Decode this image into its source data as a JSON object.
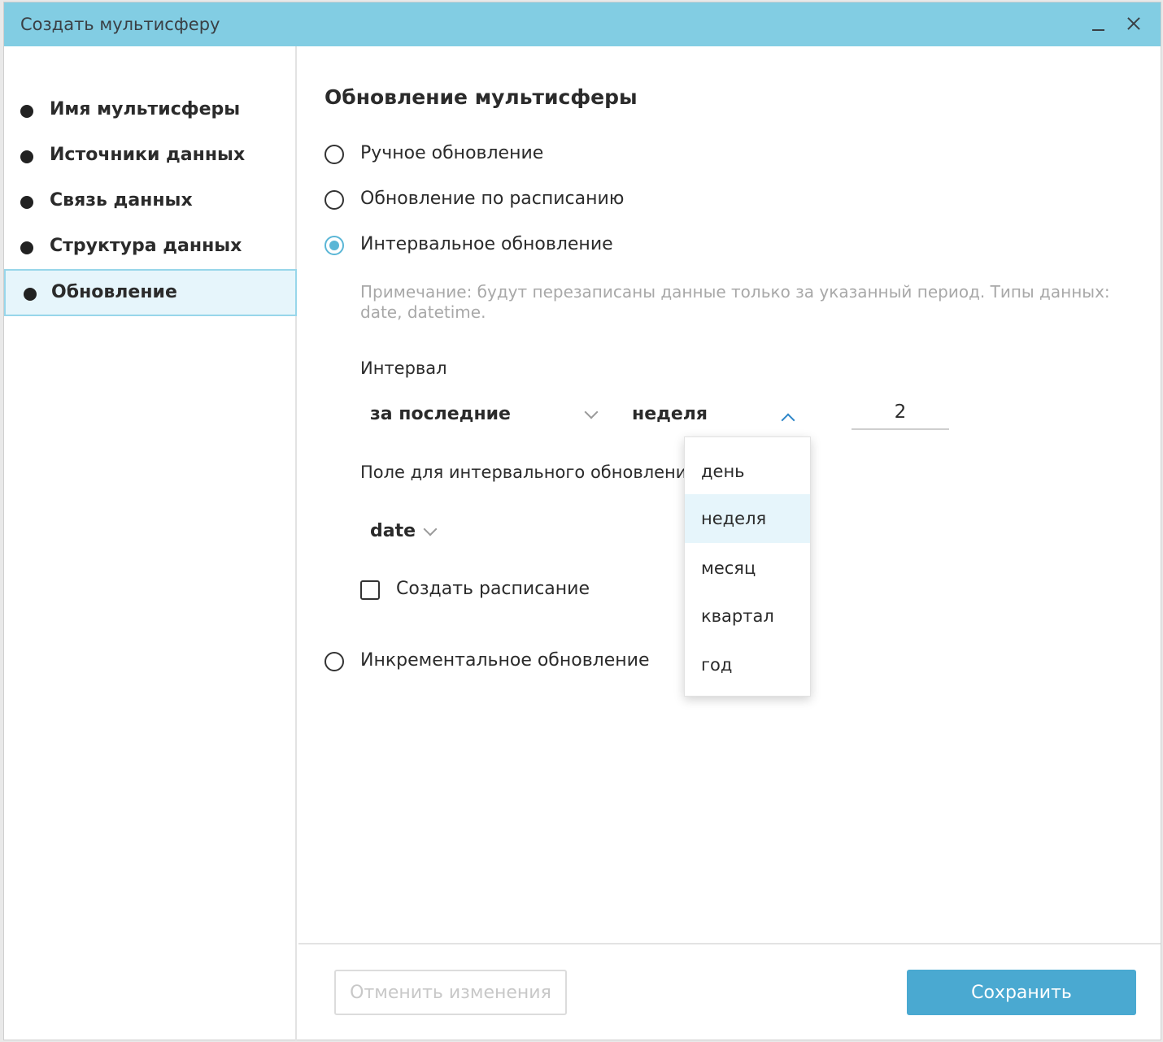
{
  "window": {
    "title": "Создать мультисферу"
  },
  "sidebar": {
    "steps": [
      {
        "label": "Имя мультисферы"
      },
      {
        "label": "Источники данных"
      },
      {
        "label": "Связь данных"
      },
      {
        "label": "Структура данных"
      },
      {
        "label": "Обновление",
        "active": true
      }
    ]
  },
  "main": {
    "heading": "Обновление мультисферы",
    "update_modes": [
      {
        "label": "Ручное обновление",
        "checked": false
      },
      {
        "label": "Обновление по расписанию",
        "checked": false
      },
      {
        "label": "Интервальное обновление",
        "checked": true
      },
      {
        "label": "Инкрементальное обновление",
        "checked": false
      }
    ],
    "note": "Примечание: будут перезаписаны данные только за указанный период. Типы данных: date, datetime.",
    "interval": {
      "label": "Интервал",
      "range_select": "за последние",
      "unit_select": "неделя",
      "count": "2"
    },
    "interval_field": {
      "label": "Поле для интервального обновления",
      "select": "date"
    },
    "create_schedule": {
      "label": "Создать расписание",
      "checked": false
    },
    "unit_dropdown": {
      "options": [
        "день",
        "неделя",
        "месяц",
        "квартал",
        "год"
      ],
      "selected": "неделя"
    }
  },
  "footer": {
    "cancel_label": "Отменить изменения",
    "save_label": "Сохранить"
  },
  "colors": {
    "titlebar": "#82cde3",
    "accent": "#5ab6d6",
    "primary_button": "#4aa9d1",
    "active_step_bg": "#e6f5fb"
  }
}
